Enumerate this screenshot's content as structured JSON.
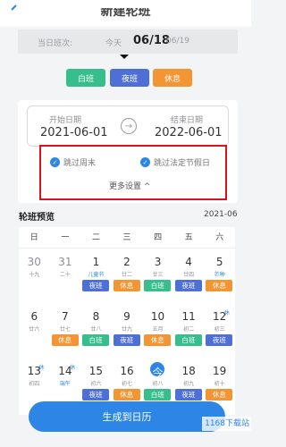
{
  "header": {
    "title": "新建轮班"
  },
  "day_strip": {
    "label": "当日班次:",
    "today": "今天",
    "main_date": "06/18",
    "next_date": "06/19"
  },
  "chips": [
    {
      "label": "白班",
      "type": "white"
    },
    {
      "label": "夜班",
      "type": "night"
    },
    {
      "label": "休息",
      "type": "rest"
    }
  ],
  "settings": {
    "start_label": "开始日期",
    "start_value": "2021-06-01",
    "end_label": "结束日期",
    "end_value": "2022-06-01",
    "arrow_glyph": "→",
    "skip_weekend": "跳过周末",
    "skip_holiday": "跳过法定节假日",
    "more": "更多设置 ^"
  },
  "preview": {
    "title": "轮班预览",
    "month": "2021-06"
  },
  "calendar": {
    "weekdays": [
      "日",
      "一",
      "二",
      "三",
      "四",
      "五",
      "六"
    ],
    "days": [
      {
        "num": "30",
        "sub": "十九",
        "gray": true
      },
      {
        "num": "31",
        "sub": "二十",
        "gray": true
      },
      {
        "num": "1",
        "sub": "儿童节",
        "sub_holiday": true,
        "tag": "夜班",
        "tag_type": "night"
      },
      {
        "num": "2",
        "sub": "廿二",
        "tag": "休息",
        "tag_type": "rest"
      },
      {
        "num": "3",
        "sub": "廿三",
        "tag": "白班",
        "tag_type": "white"
      },
      {
        "num": "4",
        "sub": "廿四",
        "tag": "夜班",
        "tag_type": "night"
      },
      {
        "num": "5",
        "sub": "芒种",
        "sub_holiday": true,
        "tag": "休息",
        "tag_type": "rest"
      },
      {
        "num": "6",
        "sub": "廿六",
        "tag": ""
      },
      {
        "num": "7",
        "sub": "廿七",
        "tag": "休息",
        "tag_type": "rest"
      },
      {
        "num": "8",
        "sub": "廿八",
        "tag": "白班",
        "tag_type": "white"
      },
      {
        "num": "9",
        "sub": "廿九",
        "tag": "夜班",
        "tag_type": "night"
      },
      {
        "num": "10",
        "sub": "五月",
        "tag": "休息",
        "tag_type": "rest"
      },
      {
        "num": "11",
        "sub": "初二",
        "tag": "白班",
        "tag_type": "white"
      },
      {
        "num": "12",
        "sub": "初三",
        "badge": "休",
        "tag": "夜班",
        "tag_type": "night"
      },
      {
        "num": "13",
        "sub": "初四",
        "badge": "休",
        "tag": ""
      },
      {
        "num": "14",
        "sub": "端午",
        "sub_holiday": true,
        "badge": "休",
        "tag": ""
      },
      {
        "num": "15",
        "sub": "初六",
        "tag": "夜班",
        "tag_type": "night"
      },
      {
        "num": "16",
        "sub": "初七",
        "tag": "休息",
        "tag_type": "rest"
      },
      {
        "num": "今",
        "sub": "初八",
        "today": true,
        "tag": "白班",
        "tag_type": "white"
      },
      {
        "num": "18",
        "sub": "初九",
        "tag": "夜班",
        "tag_type": "night"
      },
      {
        "num": "19",
        "sub": "初十",
        "tag": "休息",
        "tag_type": "rest"
      }
    ]
  },
  "generate_button": {
    "label": "生成到日历"
  },
  "watermark": {
    "text": "1168下载站"
  }
}
